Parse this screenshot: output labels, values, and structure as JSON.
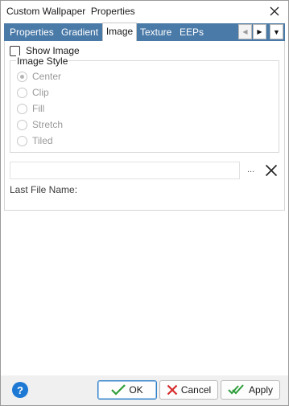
{
  "window": {
    "title": "Custom Wallpaper  Properties"
  },
  "tabs": [
    {
      "label": "Properties"
    },
    {
      "label": "Gradient"
    },
    {
      "label": "Image"
    },
    {
      "label": "Texture"
    },
    {
      "label": "EEPs"
    }
  ],
  "active_tab": "Image",
  "image_page": {
    "show_image": {
      "label": "Show Image",
      "checked": false
    },
    "style_group": {
      "legend": "Image Style",
      "options": [
        {
          "label": "Center",
          "selected": true
        },
        {
          "label": "Clip",
          "selected": false
        },
        {
          "label": "Fill",
          "selected": false
        },
        {
          "label": "Stretch",
          "selected": false
        },
        {
          "label": "Tiled",
          "selected": false
        }
      ]
    },
    "file": {
      "value": "",
      "browse_label": "...",
      "last_file_label": "Last File Name:"
    }
  },
  "footer": {
    "help_label": "?",
    "ok_label": "OK",
    "cancel_label": "Cancel",
    "apply_label": "Apply"
  },
  "colors": {
    "tab_strip": "#4a7aa8",
    "help_icon": "#1e79d4",
    "ok_check": "#2e9e3a",
    "cancel_x": "#d62b2b",
    "footer_bg": "#f0f0f0"
  }
}
